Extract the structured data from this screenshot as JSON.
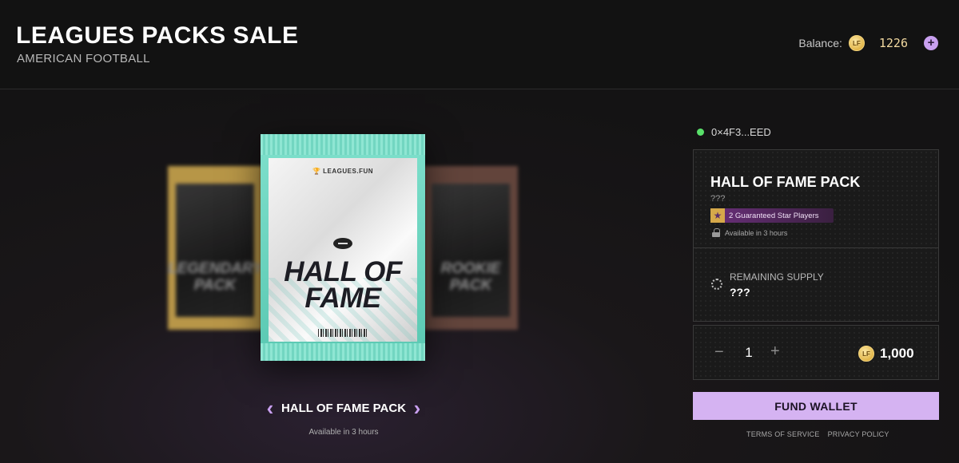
{
  "header": {
    "title": "LEAGUES PACKS SALE",
    "subtitle": "AMERICAN FOOTBALL",
    "balance_label": "Balance:",
    "currency_symbol": "LF",
    "balance_value": "1226",
    "add_funds_label": "+"
  },
  "carousel": {
    "packs": [
      {
        "text_line1": "LEGENDARY",
        "text_line2": "PACK",
        "color": "#c9a44d"
      },
      {
        "brand": "🏆 LEAGUES.FUN",
        "text_line1": "HALL OF",
        "text_line2": "FAME",
        "color": "#5ac8b2"
      },
      {
        "text_line1": "ROOKIE",
        "text_line2": "PACK",
        "color": "#6b4a40"
      }
    ],
    "prev_label": "‹",
    "next_label": "›",
    "selected_name": "HALL OF FAME PACK",
    "availability": "Available in 3 hours"
  },
  "wallet": {
    "address": "0×4F3...EED",
    "status_color": "#59e06a"
  },
  "pack_details": {
    "title": "HALL OF FAME PACK",
    "description": "???",
    "badge_icon": "★",
    "badge_text": "2 Guaranteed Star Players",
    "availability": "Available in 3 hours",
    "supply_label": "REMAINING SUPPLY",
    "supply_value": "???"
  },
  "purchase": {
    "minus_label": "−",
    "quantity": "1",
    "plus_label": "+",
    "currency_symbol": "LF",
    "price": "1,000",
    "fund_button": "FUND WALLET"
  },
  "footer": {
    "terms": "TERMS OF SERVICE",
    "privacy": "PRIVACY POLICY"
  },
  "colors": {
    "accent": "#d5b3f2",
    "coin": "#e2b64a"
  }
}
